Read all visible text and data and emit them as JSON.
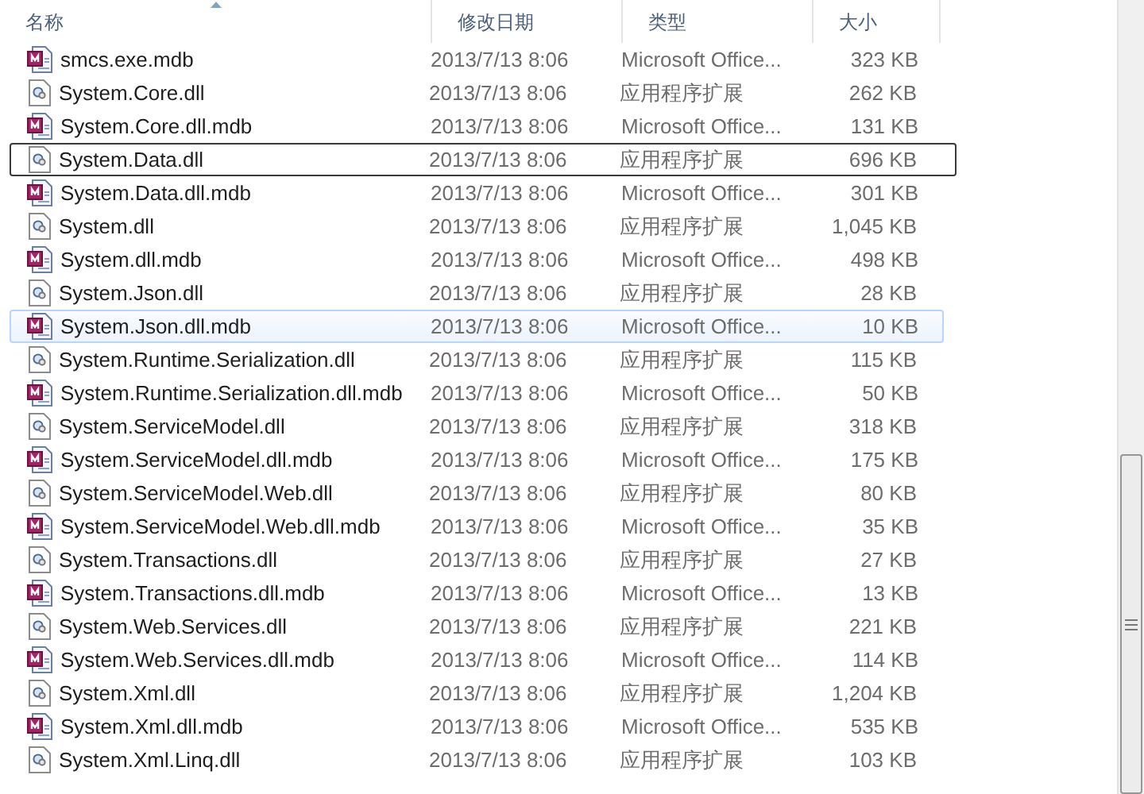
{
  "columns": [
    {
      "label": "名称",
      "sorted": true
    },
    {
      "label": "修改日期",
      "sorted": false
    },
    {
      "label": "类型",
      "sorted": false
    },
    {
      "label": "大小",
      "sorted": false
    }
  ],
  "rows": [
    {
      "kind": "mdb",
      "name": "smcs.exe.mdb",
      "modified": "2013/7/13 8:06",
      "type": "Microsoft Office...",
      "size": "323 KB",
      "hovered": false,
      "outlined": false
    },
    {
      "kind": "dll",
      "name": "System.Core.dll",
      "modified": "2013/7/13 8:06",
      "type": "应用程序扩展",
      "size": "262 KB",
      "hovered": false,
      "outlined": false
    },
    {
      "kind": "mdb",
      "name": "System.Core.dll.mdb",
      "modified": "2013/7/13 8:06",
      "type": "Microsoft Office...",
      "size": "131 KB",
      "hovered": false,
      "outlined": false
    },
    {
      "kind": "dll",
      "name": "System.Data.dll",
      "modified": "2013/7/13 8:06",
      "type": "应用程序扩展",
      "size": "696 KB",
      "hovered": false,
      "outlined": true
    },
    {
      "kind": "mdb",
      "name": "System.Data.dll.mdb",
      "modified": "2013/7/13 8:06",
      "type": "Microsoft Office...",
      "size": "301 KB",
      "hovered": false,
      "outlined": false
    },
    {
      "kind": "dll",
      "name": "System.dll",
      "modified": "2013/7/13 8:06",
      "type": "应用程序扩展",
      "size": "1,045 KB",
      "hovered": false,
      "outlined": false
    },
    {
      "kind": "mdb",
      "name": "System.dll.mdb",
      "modified": "2013/7/13 8:06",
      "type": "Microsoft Office...",
      "size": "498 KB",
      "hovered": false,
      "outlined": false
    },
    {
      "kind": "dll",
      "name": "System.Json.dll",
      "modified": "2013/7/13 8:06",
      "type": "应用程序扩展",
      "size": "28 KB",
      "hovered": false,
      "outlined": false
    },
    {
      "kind": "mdb",
      "name": "System.Json.dll.mdb",
      "modified": "2013/7/13 8:06",
      "type": "Microsoft Office...",
      "size": "10 KB",
      "hovered": true,
      "outlined": false
    },
    {
      "kind": "dll",
      "name": "System.Runtime.Serialization.dll",
      "modified": "2013/7/13 8:06",
      "type": "应用程序扩展",
      "size": "115 KB",
      "hovered": false,
      "outlined": false
    },
    {
      "kind": "mdb",
      "name": "System.Runtime.Serialization.dll.mdb",
      "modified": "2013/7/13 8:06",
      "type": "Microsoft Office...",
      "size": "50 KB",
      "hovered": false,
      "outlined": false
    },
    {
      "kind": "dll",
      "name": "System.ServiceModel.dll",
      "modified": "2013/7/13 8:06",
      "type": "应用程序扩展",
      "size": "318 KB",
      "hovered": false,
      "outlined": false
    },
    {
      "kind": "mdb",
      "name": "System.ServiceModel.dll.mdb",
      "modified": "2013/7/13 8:06",
      "type": "Microsoft Office...",
      "size": "175 KB",
      "hovered": false,
      "outlined": false
    },
    {
      "kind": "dll",
      "name": "System.ServiceModel.Web.dll",
      "modified": "2013/7/13 8:06",
      "type": "应用程序扩展",
      "size": "80 KB",
      "hovered": false,
      "outlined": false
    },
    {
      "kind": "mdb",
      "name": "System.ServiceModel.Web.dll.mdb",
      "modified": "2013/7/13 8:06",
      "type": "Microsoft Office...",
      "size": "35 KB",
      "hovered": false,
      "outlined": false
    },
    {
      "kind": "dll",
      "name": "System.Transactions.dll",
      "modified": "2013/7/13 8:06",
      "type": "应用程序扩展",
      "size": "27 KB",
      "hovered": false,
      "outlined": false
    },
    {
      "kind": "mdb",
      "name": "System.Transactions.dll.mdb",
      "modified": "2013/7/13 8:06",
      "type": "Microsoft Office...",
      "size": "13 KB",
      "hovered": false,
      "outlined": false
    },
    {
      "kind": "dll",
      "name": "System.Web.Services.dll",
      "modified": "2013/7/13 8:06",
      "type": "应用程序扩展",
      "size": "221 KB",
      "hovered": false,
      "outlined": false
    },
    {
      "kind": "mdb",
      "name": "System.Web.Services.dll.mdb",
      "modified": "2013/7/13 8:06",
      "type": "Microsoft Office...",
      "size": "114 KB",
      "hovered": false,
      "outlined": false
    },
    {
      "kind": "dll",
      "name": "System.Xml.dll",
      "modified": "2013/7/13 8:06",
      "type": "应用程序扩展",
      "size": "1,204 KB",
      "hovered": false,
      "outlined": false
    },
    {
      "kind": "mdb",
      "name": "System.Xml.dll.mdb",
      "modified": "2013/7/13 8:06",
      "type": "Microsoft Office...",
      "size": "535 KB",
      "hovered": false,
      "outlined": false
    },
    {
      "kind": "dll",
      "name": "System.Xml.Linq.dll",
      "modified": "2013/7/13 8:06",
      "type": "应用程序扩展",
      "size": "103 KB",
      "hovered": false,
      "outlined": false
    }
  ]
}
